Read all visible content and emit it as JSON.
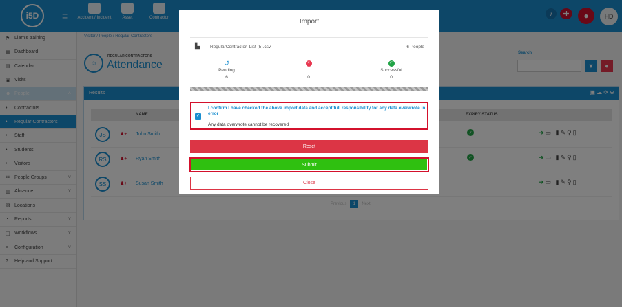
{
  "header": {
    "logo": "i5D",
    "nav": [
      {
        "label": "Accident / Incident"
      },
      {
        "label": "Asset"
      },
      {
        "label": "Contractor"
      }
    ],
    "avatar_initials": "HD"
  },
  "sidebar": {
    "items": [
      {
        "label": "Liam's training"
      },
      {
        "label": "Dashboard"
      },
      {
        "label": "Calendar"
      },
      {
        "label": "Visits"
      },
      {
        "label": "People"
      },
      {
        "label": "Contractors"
      },
      {
        "label": "Regular Contractors"
      },
      {
        "label": "Staff"
      },
      {
        "label": "Students"
      },
      {
        "label": "Visitors"
      },
      {
        "label": "People Groups"
      },
      {
        "label": "Absence"
      },
      {
        "label": "Locations"
      },
      {
        "label": "Reports"
      },
      {
        "label": "Workflows"
      },
      {
        "label": "Configuration"
      },
      {
        "label": "Help and Support"
      }
    ]
  },
  "breadcrumb": {
    "items": [
      "Visitor",
      "People",
      "Regular Contractors"
    ]
  },
  "page": {
    "preheading": "REGULAR CONTRACTORS",
    "title": "Attendance"
  },
  "search": {
    "label": "Search",
    "value": ""
  },
  "results": {
    "title": "Results",
    "columns": {
      "name": "NAME",
      "expiry": "EXPIRY STATUS"
    },
    "rows": [
      {
        "initials": "JS",
        "name": "John Smith",
        "expiry_ok": true
      },
      {
        "initials": "RS",
        "name": "Ryan Smith",
        "expiry_ok": true
      },
      {
        "initials": "SS",
        "name": "Susan Smith",
        "expiry_ok": false
      }
    ]
  },
  "pagination": {
    "prev": "Previous",
    "current": "1",
    "next": "Next"
  },
  "modal": {
    "title": "Import",
    "file_name": "RegularContractor_List (5).csv",
    "file_count": "6 People",
    "stats": [
      {
        "label": "Pending",
        "value": "6",
        "icon": "history-icon",
        "color": "#1b8fd0"
      },
      {
        "label": "",
        "value": "0",
        "icon": "error-icon",
        "color": "#e8364f"
      },
      {
        "label": "Successful",
        "value": "0",
        "icon": "check-icon",
        "color": "#22a447"
      }
    ],
    "confirm_text": "I confirm I have checked the above import data and accept full responsibility for any data overwrote in error",
    "warning_text": "Any data overwrote cannot be recovered",
    "buttons": {
      "reset": "Reset",
      "submit": "Submit",
      "close": "Close"
    }
  },
  "colors": {
    "primary": "#1b8fd0",
    "danger": "#dc3545",
    "success": "#2fc010",
    "highlight": "#d3112c"
  }
}
